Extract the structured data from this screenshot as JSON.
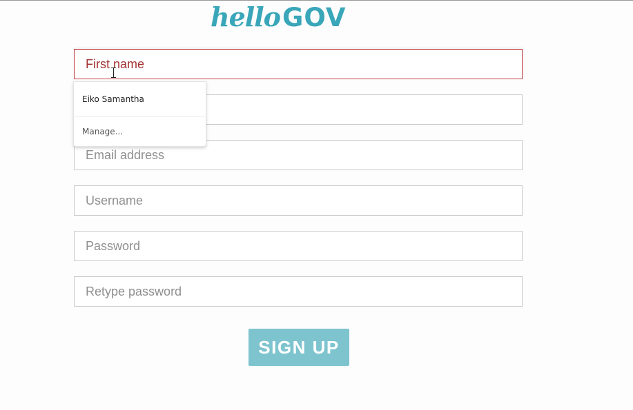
{
  "header": {
    "logo_hello": "hello",
    "logo_gov": "GOV",
    "brand_color": "#3aa6b9"
  },
  "form": {
    "first_name": {
      "placeholder": "First name",
      "value": ""
    },
    "last_name": {
      "placeholder": "",
      "value": ""
    },
    "email": {
      "placeholder": "Email address",
      "value": ""
    },
    "username": {
      "placeholder": "Username",
      "value": ""
    },
    "password": {
      "placeholder": "Password",
      "value": ""
    },
    "retype_password": {
      "placeholder": "Retype password",
      "value": ""
    },
    "submit_label": "SIGN UP",
    "active_border_color": "#c23a3a",
    "button_color": "#7ec4cf"
  },
  "autofill": {
    "suggestion": "Eiko Samantha",
    "manage_label": "Manage..."
  }
}
